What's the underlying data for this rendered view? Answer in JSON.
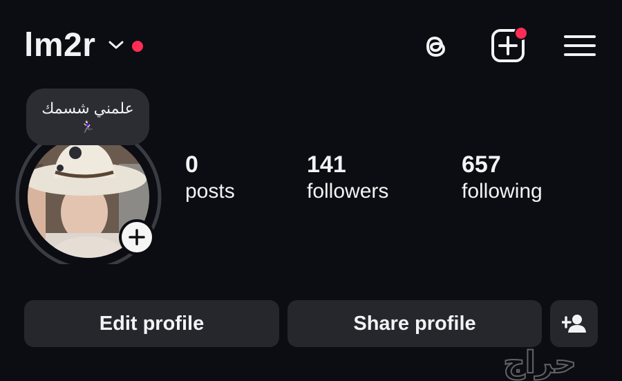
{
  "header": {
    "username": "lm2r",
    "icons": [
      "chevron-down-icon",
      "threads-icon",
      "create-post-icon",
      "menu-icon"
    ],
    "notification_dot_color": "#ff2d55"
  },
  "note": {
    "text": "علمني شسمك",
    "emoji": "🏃🏻‍♀️"
  },
  "stats": {
    "posts": {
      "count": "0",
      "label": "posts"
    },
    "followers": {
      "count": "141",
      "label": "followers"
    },
    "following": {
      "count": "657",
      "label": "following"
    }
  },
  "actions": {
    "edit_label": "Edit profile",
    "share_label": "Share profile",
    "add_user_icon": "add-user-icon"
  },
  "watermark": {
    "text": "حراج"
  },
  "colors": {
    "background": "#0c0d12",
    "button_bg": "#25272d",
    "text": "#f2f3f5",
    "accent_dot": "#ff2d55"
  }
}
